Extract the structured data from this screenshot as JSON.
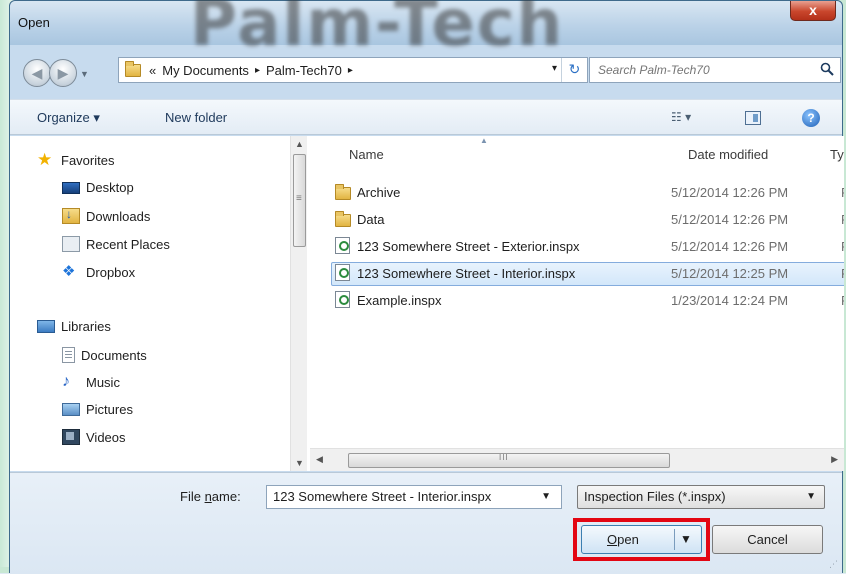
{
  "window": {
    "title": "Open",
    "close_label": "x",
    "background_logo": "Palm-Tech"
  },
  "address_bar": {
    "overflow": "«",
    "crumbs": [
      "My Documents",
      "Palm-Tech70"
    ],
    "separator": "▸",
    "dropdown": "▾",
    "refresh": "↻"
  },
  "search": {
    "placeholder": "Search Palm-Tech70"
  },
  "toolbar": {
    "organize_label": "Organize ▾",
    "new_folder_label": "New folder",
    "views_label": "☷ ▾",
    "help_label": "?"
  },
  "nav_pane": {
    "favorites": {
      "label": "Favorites",
      "items": [
        "Desktop",
        "Downloads",
        "Recent Places",
        "Dropbox"
      ]
    },
    "libraries": {
      "label": "Libraries",
      "items": [
        "Documents",
        "Music",
        "Pictures",
        "Videos"
      ]
    }
  },
  "file_list": {
    "columns": {
      "name": "Name",
      "date": "Date modified",
      "type": "Ty"
    },
    "rows": [
      {
        "name": "Archive",
        "date": "5/12/2014 12:26 PM",
        "type": "Fi",
        "kind": "folder"
      },
      {
        "name": "Data",
        "date": "5/12/2014 12:26 PM",
        "type": "Fi",
        "kind": "folder"
      },
      {
        "name": "123 Somewhere Street - Exterior.inspx",
        "date": "5/12/2014 12:26 PM",
        "type": "P",
        "kind": "inspx"
      },
      {
        "name": "123 Somewhere Street - Interior.inspx",
        "date": "5/12/2014 12:25 PM",
        "type": "P",
        "kind": "inspx",
        "selected": true
      },
      {
        "name": "Example.inspx",
        "date": "1/23/2014 12:24 PM",
        "type": "P",
        "kind": "inspx"
      }
    ]
  },
  "bottom": {
    "file_name_label_pre": "File ",
    "file_name_label_u": "n",
    "file_name_label_post": "ame:",
    "file_name_value": "123 Somewhere Street - Interior.inspx",
    "filter_value": "Inspection Files (*.inspx)",
    "open_label_u": "O",
    "open_label_post": "pen",
    "cancel_label": "Cancel"
  },
  "colors": {
    "highlight": "#e30613",
    "selection": "#d3e7fa"
  }
}
